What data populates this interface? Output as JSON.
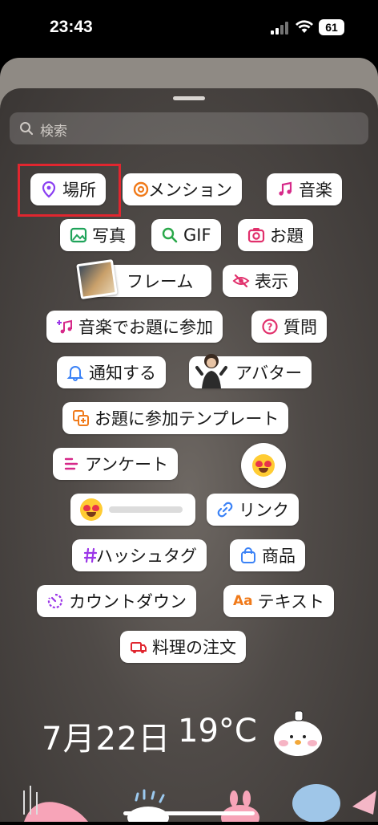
{
  "status_bar": {
    "time": "23:43",
    "battery": "61"
  },
  "search": {
    "placeholder": "検索"
  },
  "stickers": {
    "location": "場所",
    "mention": "メンション",
    "music": "音楽",
    "photo": "写真",
    "gif": "GIF",
    "question": "お題",
    "frame": "フレーム",
    "reveal": "表示",
    "music_challenge": "音楽でお題に参加",
    "questions": "質問",
    "notify": "通知する",
    "avatar": "アバター",
    "template": "お題に参加テンプレート",
    "poll": "アンケート",
    "link": "リンク",
    "hashtag": "ハッシュタグ",
    "product": "商品",
    "countdown": "カウントダウン",
    "text_prefix": "Aa",
    "text": "テキスト",
    "food_order": "料理の注文",
    "slider_value": 0.0
  },
  "bottom_row": {
    "date": "7月22日",
    "temperature": "19°C"
  },
  "colors": {
    "location_icon": "#8a3ff2",
    "mention_icon": "#f07a1a",
    "music_icon": "#d62989",
    "photo_icon": "#1fa35a",
    "gif_icon": "#2aa84a",
    "question_icon": "#e1306c",
    "reveal_icon": "#e1306c",
    "notify_icon": "#3b82f6",
    "link_icon": "#3b82f6",
    "hashtag_icon": "#9b36e8",
    "product_icon": "#3b82f6",
    "countdown_icon": "#9b36e8",
    "text_icon": "#f07a1a",
    "food_icon": "#e0262f",
    "highlight": "#e0262f"
  }
}
